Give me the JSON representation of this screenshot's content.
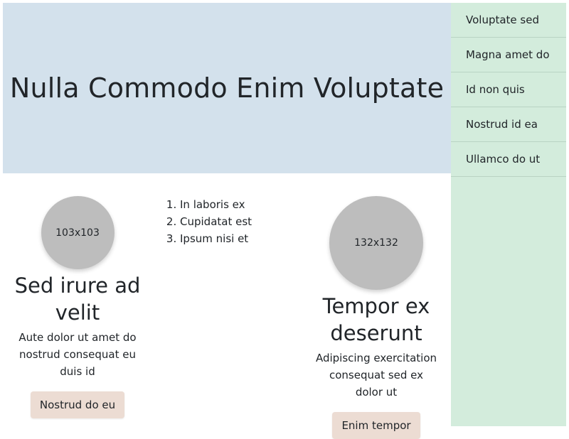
{
  "hero": {
    "title": "Nulla Commodo Enim Voluptate"
  },
  "sidebar": {
    "items": [
      {
        "label": "Voluptate sed"
      },
      {
        "label": "Magna amet do"
      },
      {
        "label": "Id non quis"
      },
      {
        "label": "Nostrud id ea"
      },
      {
        "label": "Ullamco do ut"
      }
    ]
  },
  "cards": [
    {
      "image_label": "103x103",
      "title": "Sed irure ad velit",
      "body": "Aute dolor ut amet do nostrud consequat eu duis id",
      "button": "Nostrud do eu"
    },
    {
      "image_label": "132x132",
      "title": "Tempor ex deserunt",
      "body": "Adipiscing exercitation consequat sed ex dolor ut",
      "button": "Enim tempor"
    }
  ],
  "list": {
    "items": [
      "In laboris ex",
      "Cupidatat est",
      "Ipsum nisi et"
    ]
  },
  "colors": {
    "hero_bg": "#d3e1ec",
    "sidebar_bg": "#d3ecdc",
    "button_bg": "#ecdcd3",
    "avatar_bg": "#bdbdbd"
  }
}
